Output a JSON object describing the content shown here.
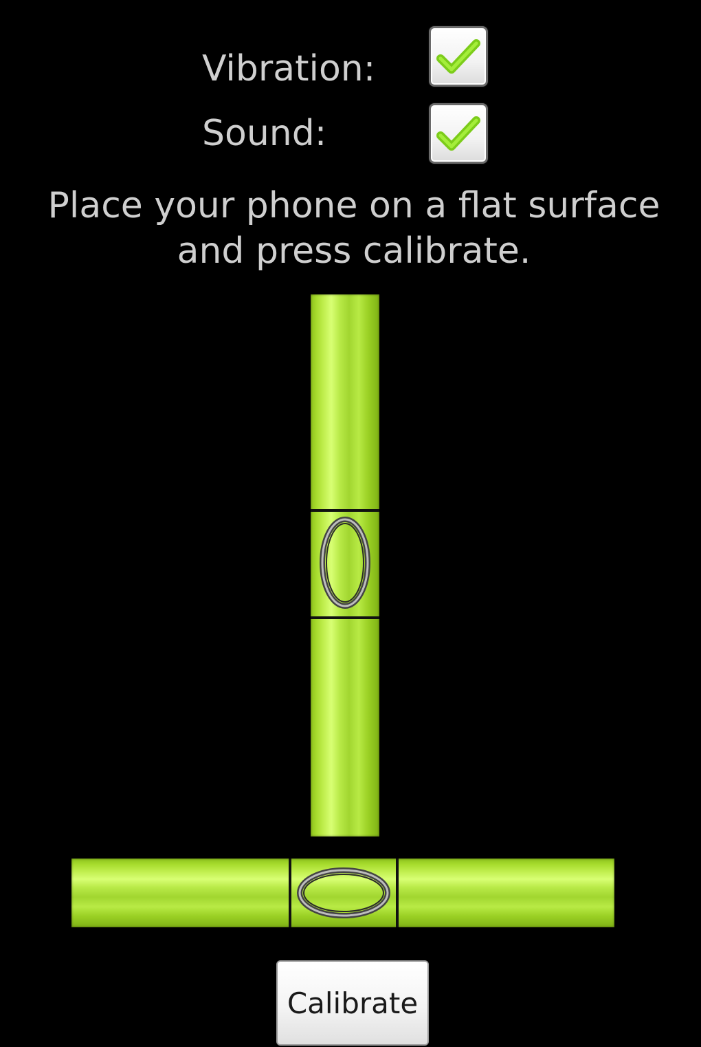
{
  "settings": {
    "vibration": {
      "label": "Vibration:",
      "checked": true
    },
    "sound": {
      "label": "Sound:",
      "checked": true
    }
  },
  "instructions": {
    "line1": "Place your phone on a flat surface",
    "line2": "and press calibrate."
  },
  "calibrate_button": {
    "label": "Calibrate"
  },
  "colors": {
    "background": "#000000",
    "text": "#cfcfcf",
    "vial_green": "#b9ea48",
    "check_green": "#7ccc1a"
  },
  "icons": {
    "checkmark": "check-icon",
    "bubble": "bubble-icon"
  }
}
